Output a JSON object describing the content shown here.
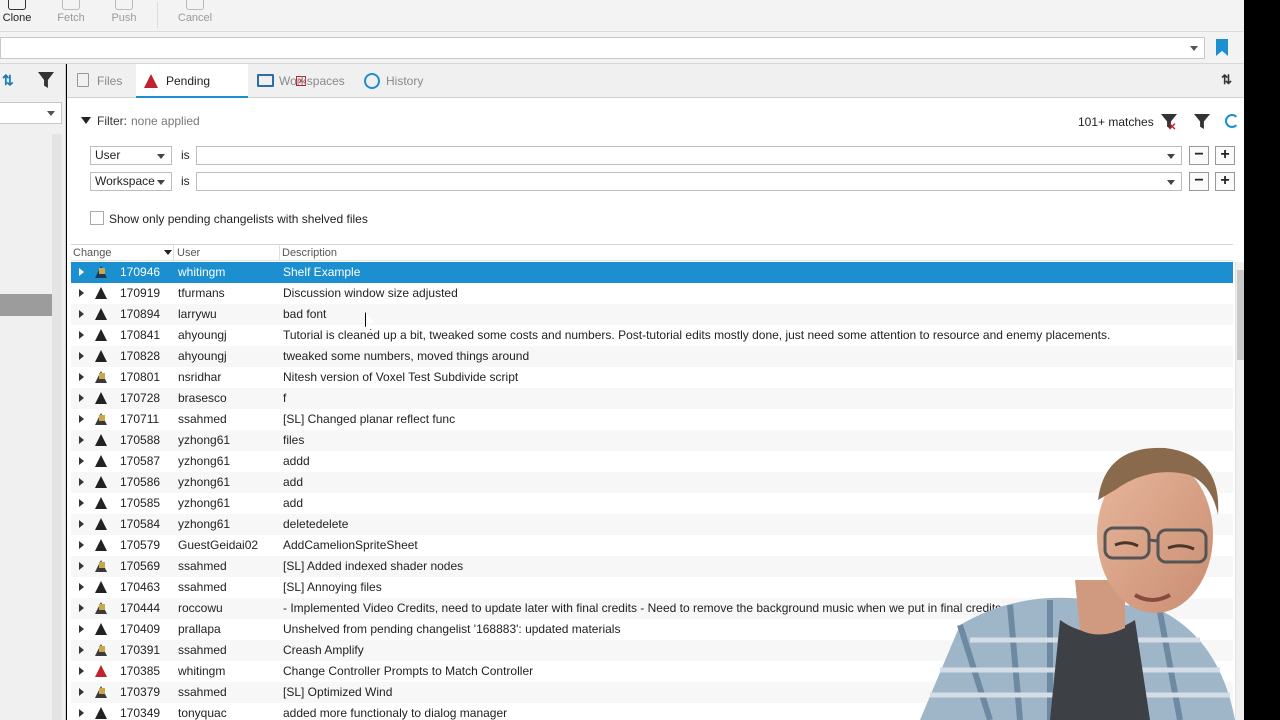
{
  "toolbar": {
    "buttons": [
      {
        "label": "Clone",
        "active": true
      },
      {
        "label": "Fetch",
        "active": false
      },
      {
        "label": "Push",
        "active": false
      },
      {
        "label": "Cancel",
        "active": false
      }
    ]
  },
  "tabs": [
    {
      "label": "Files",
      "icon": "files-icon"
    },
    {
      "label": "Pending",
      "icon": "pending-icon",
      "active": true
    },
    {
      "label": "Workspaces",
      "icon": "workspaces-icon"
    },
    {
      "label": "History",
      "icon": "history-icon"
    }
  ],
  "filter": {
    "label": "Filter:",
    "state": "none applied",
    "matches": "101+ matches",
    "rows": [
      {
        "field": "User",
        "op": "is",
        "value": ""
      },
      {
        "field": "Workspace",
        "op": "is",
        "value": ""
      }
    ],
    "shelved_only_label": "Show only pending changelists with shelved files",
    "shelved_only_checked": false
  },
  "table": {
    "columns": [
      "Change",
      "User",
      "Description"
    ],
    "rows": [
      {
        "change": "170946",
        "user": "whitingm",
        "desc": "Shelf Example",
        "icon": "shelved",
        "selected": true
      },
      {
        "change": "170919",
        "user": "tfurmans",
        "desc": "Discussion window size adjusted",
        "icon": "pending"
      },
      {
        "change": "170894",
        "user": "larrywu",
        "desc": "bad font",
        "icon": "pending"
      },
      {
        "change": "170841",
        "user": "ahyoungj",
        "desc": "Tutorial is cleaned up a bit, tweaked some costs and numbers. Post-tutorial edits mostly done, just need some attention to resource and enemy placements.",
        "icon": "pending"
      },
      {
        "change": "170828",
        "user": "ahyoungj",
        "desc": "tweaked some numbers, moved things around",
        "icon": "pending"
      },
      {
        "change": "170801",
        "user": "nsridhar",
        "desc": "Nitesh version of Voxel Test Subdivide script",
        "icon": "shelved"
      },
      {
        "change": "170728",
        "user": "brasesco",
        "desc": "f",
        "icon": "pending"
      },
      {
        "change": "170711",
        "user": "ssahmed",
        "desc": "[SL] Changed planar reflect func",
        "icon": "shelved"
      },
      {
        "change": "170588",
        "user": "yzhong61",
        "desc": "files",
        "icon": "pending"
      },
      {
        "change": "170587",
        "user": "yzhong61",
        "desc": "addd",
        "icon": "pending"
      },
      {
        "change": "170586",
        "user": "yzhong61",
        "desc": "add",
        "icon": "pending"
      },
      {
        "change": "170585",
        "user": "yzhong61",
        "desc": "add",
        "icon": "pending"
      },
      {
        "change": "170584",
        "user": "yzhong61",
        "desc": "deletedelete",
        "icon": "pending"
      },
      {
        "change": "170579",
        "user": "GuestGeidai02",
        "desc": "AddCamelionSpriteSheet",
        "icon": "pending"
      },
      {
        "change": "170569",
        "user": "ssahmed",
        "desc": "[SL] Added indexed shader nodes",
        "icon": "shelved"
      },
      {
        "change": "170463",
        "user": "ssahmed",
        "desc": "[SL] Annoying files",
        "icon": "pending"
      },
      {
        "change": "170444",
        "user": "roccowu",
        "desc": "- Implemented Video Credits, need to update later with final credits - Need to remove the background music when we put in final credits - Problem with Eve...ing fr...",
        "icon": "shelved"
      },
      {
        "change": "170409",
        "user": "prallapa",
        "desc": "Unshelved from pending changelist '168883': updated materials",
        "icon": "pending"
      },
      {
        "change": "170391",
        "user": "ssahmed",
        "desc": "Creash Amplify",
        "icon": "shelved"
      },
      {
        "change": "170385",
        "user": "whitingm",
        "desc": "Change Controller Prompts to Match Controller",
        "icon": "red"
      },
      {
        "change": "170379",
        "user": "ssahmed",
        "desc": "[SL] Optimized Wind",
        "icon": "shelved"
      },
      {
        "change": "170349",
        "user": "tonyquac",
        "desc": "added more functionaly to dialog manager",
        "icon": "pending"
      }
    ]
  }
}
